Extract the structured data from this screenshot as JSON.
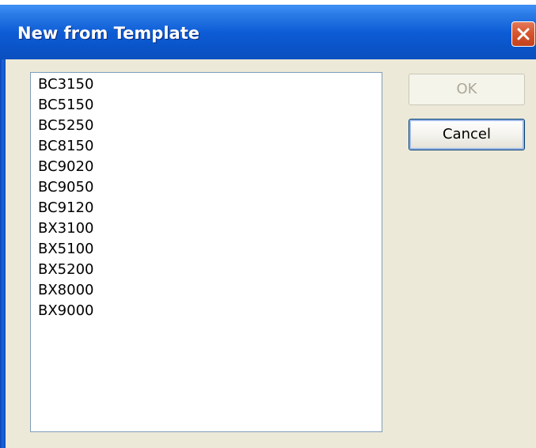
{
  "window": {
    "title": "New from Template"
  },
  "template_list": {
    "items": [
      "BC3150",
      "BC5150",
      "BC5250",
      "BC8150",
      "BC9020",
      "BC9050",
      "BC9120",
      "BX3100",
      "BX5100",
      "BX5200",
      "BX8000",
      "BX9000"
    ]
  },
  "buttons": {
    "ok_label": "OK",
    "ok_enabled": false,
    "cancel_label": "Cancel"
  },
  "colors": {
    "titlebar": "#0a54c8",
    "close_button": "#d8562f",
    "dialog_background": "#ece9d8",
    "list_border": "#7f9db9",
    "disabled_text": "#aca899"
  },
  "icons": {
    "close": "close-icon"
  }
}
